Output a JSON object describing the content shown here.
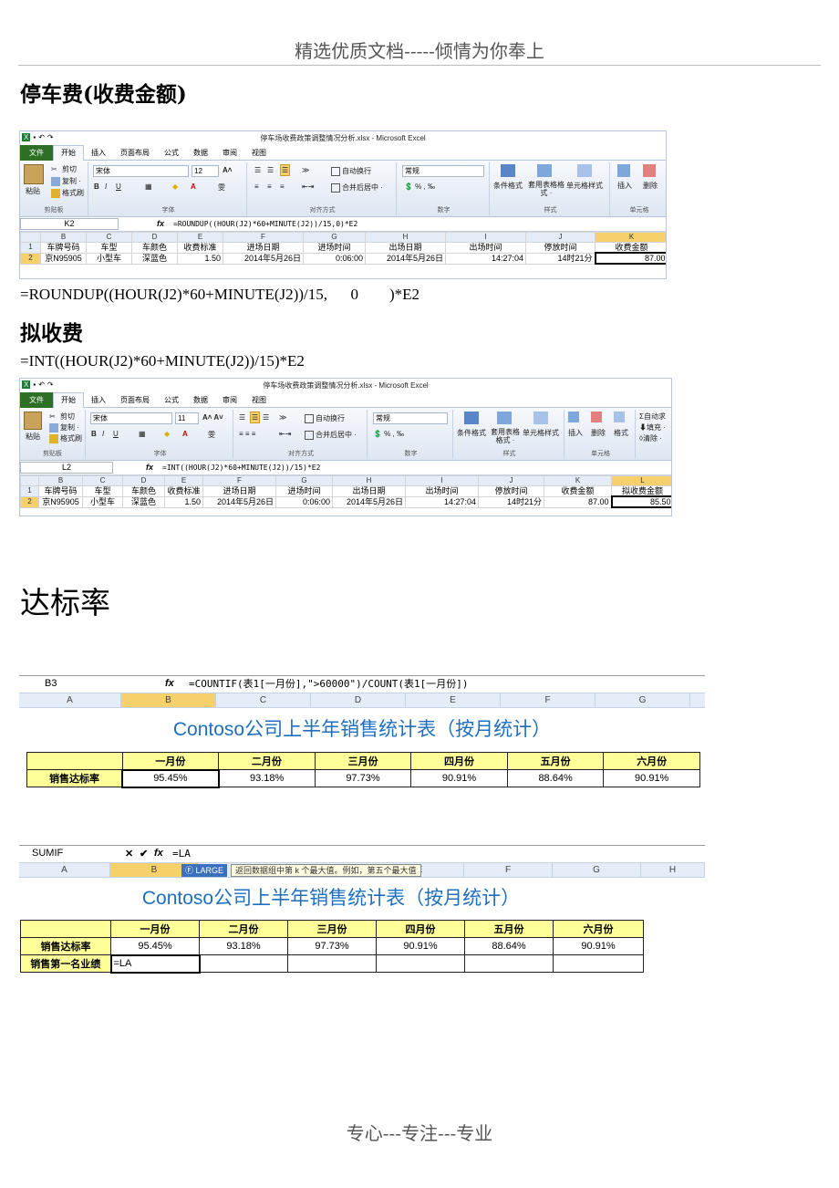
{
  "header": "精选优质文档-----倾情为你奉上",
  "footer": "专心---专注---专业",
  "section1": {
    "title": "停车费(收费金额)",
    "formula": "=ROUNDUP((HOUR(J2)*60+MINUTE(J2))/15,      0        )*E2"
  },
  "section2": {
    "title": "拟收费",
    "formula": "=INT((HOUR(J2)*60+MINUTE(J2))/15)*E2"
  },
  "section3": {
    "title": "达标率"
  },
  "excel1": {
    "window_title": "停车场收费政策调整情况分析.xlsx - Microsoft Excel",
    "tabs": [
      "文件",
      "开始",
      "插入",
      "页面布局",
      "公式",
      "数据",
      "审阅",
      "视图"
    ],
    "ribbon": {
      "paste": "粘贴",
      "cut": "剪切",
      "copy": "复制 ·",
      "format_painter": "格式刷",
      "clipboard": "剪贴板",
      "font_name": "宋体",
      "font_size": "12",
      "font_group": "字体",
      "wrap": "自动换行",
      "merge": "合并后居中 ·",
      "align_group": "对齐方式",
      "number_format": "常规",
      "number_group": "数字",
      "cond_format": "条件格式",
      "table_format": "套用表格格式 ·",
      "cell_style": "单元格样式",
      "style_group": "样式",
      "insert": "插入",
      "delete": "删除",
      "cells_group": "单元格"
    },
    "namebox": "K2",
    "formula": "=ROUNDUP((HOUR(J2)*60+MINUTE(J2))/15,0)*E2",
    "cols": [
      "B",
      "C",
      "D",
      "E",
      "F",
      "G",
      "H",
      "I",
      "J",
      "K"
    ],
    "headers": [
      "车牌号码",
      "车型",
      "车颜色",
      "收费标准",
      "进场日期",
      "进场时间",
      "出场日期",
      "出场时间",
      "停放时间",
      "收费金额"
    ],
    "row": [
      "京N95905",
      "小型车",
      "深蓝色",
      "1.50",
      "2014年5月26日",
      "0:06:00",
      "2014年5月26日",
      "14:27:04",
      "14时21分",
      "87.00"
    ]
  },
  "excel2": {
    "window_title": "停车场收费政策调整情况分析.xlsx - Microsoft Excel",
    "tabs": [
      "文件",
      "开始",
      "插入",
      "页面布局",
      "公式",
      "数据",
      "审阅",
      "视图"
    ],
    "ribbon": {
      "paste": "粘贴",
      "cut": "剪切",
      "copy": "复制 ·",
      "format_painter": "格式刷",
      "clipboard": "剪贴板",
      "font_name": "宋体",
      "font_size": "11",
      "font_group": "字体",
      "wrap": "自动换行",
      "merge": "合并后居中 ·",
      "align_group": "对齐方式",
      "number_format": "常规",
      "number_group": "数字",
      "cond_format": "条件格式",
      "table_format": "套用表格格式 ·",
      "cell_style": "单元格样式",
      "style_group": "样式",
      "insert": "插入",
      "delete": "删除",
      "format": "格式",
      "cells_group": "单元格",
      "autosum": "自动求",
      "fill": "填充 ·",
      "clear": "清除 ·"
    },
    "namebox": "L2",
    "formula": "=INT((HOUR(J2)*60+MINUTE(J2))/15)*E2",
    "cols": [
      "B",
      "C",
      "D",
      "E",
      "F",
      "G",
      "H",
      "I",
      "J",
      "K",
      "L"
    ],
    "headers": [
      "车牌号码",
      "车型",
      "车颜色",
      "收费标准",
      "进场日期",
      "进场时间",
      "出场日期",
      "出场时间",
      "停放时间",
      "收费金额",
      "拟收费金额"
    ],
    "row": [
      "京N95905",
      "小型车",
      "深蓝色",
      "1.50",
      "2014年5月26日",
      "0:06:00",
      "2014年5月26日",
      "14:27:04",
      "14时21分",
      "87.00",
      "85.50"
    ]
  },
  "sheet3": {
    "namebox": "B3",
    "formula": "=COUNTIF(表1[一月份],\">60000\")/COUNT(表1[一月份])",
    "cols": [
      "A",
      "B",
      "C",
      "D",
      "E",
      "F",
      "G"
    ],
    "title": "Contoso公司上半年销售统计表（按月统计）",
    "months": [
      "一月份",
      "二月份",
      "三月份",
      "四月份",
      "五月份",
      "六月份"
    ],
    "row_label": "销售达标率",
    "values": [
      "95.45%",
      "93.18%",
      "97.73%",
      "90.91%",
      "88.64%",
      "90.91%"
    ]
  },
  "sheet4": {
    "namebox": "SUMIF",
    "formula": "=LA",
    "cols": [
      "A",
      "B",
      "C",
      "D",
      "E",
      "F",
      "G",
      "H"
    ],
    "autocomplete": "LARGE",
    "tooltip": "返回数据组中第 k 个最大值。例如，第五个最大值",
    "title": "Contoso公司上半年销售统计表（按月统计）",
    "months": [
      "一月份",
      "二月份",
      "三月份",
      "四月份",
      "五月份",
      "六月份"
    ],
    "row_label": "销售达标率",
    "values": [
      "95.45%",
      "93.18%",
      "97.73%",
      "90.91%",
      "88.64%",
      "90.91%"
    ],
    "row2_label": "销售第一名业绩",
    "row2_value": "=LA"
  }
}
